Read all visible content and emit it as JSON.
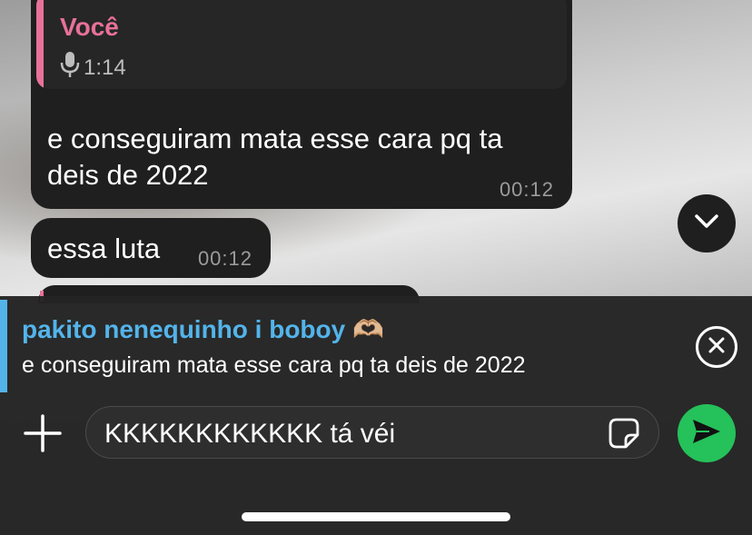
{
  "chat": {
    "messages": [
      {
        "quote": {
          "author": "Você",
          "audio_duration": "1:14"
        },
        "text": "e conseguiram mata esse cara pq ta deis de 2022",
        "time": "00:12"
      },
      {
        "text": "essa luta",
        "time": "00:12"
      }
    ]
  },
  "reply_preview": {
    "name": "pakito nenequinho i boboy 🫶🏼",
    "text": "e conseguiram mata esse cara pq ta deis de 2022"
  },
  "composer": {
    "value": "KKKKKKKKKKKK tá véi"
  },
  "colors": {
    "bubble": "#1f1f1f",
    "quote_accent": "#e8719a",
    "reply_accent": "#53b4ea",
    "send_button": "#25c15a"
  },
  "icons": {
    "audio": "microphone-icon",
    "scroll_down": "chevron-down-icon",
    "close_reply": "close-icon",
    "attach": "plus-icon",
    "sticker": "sticker-icon",
    "send": "send-icon"
  }
}
